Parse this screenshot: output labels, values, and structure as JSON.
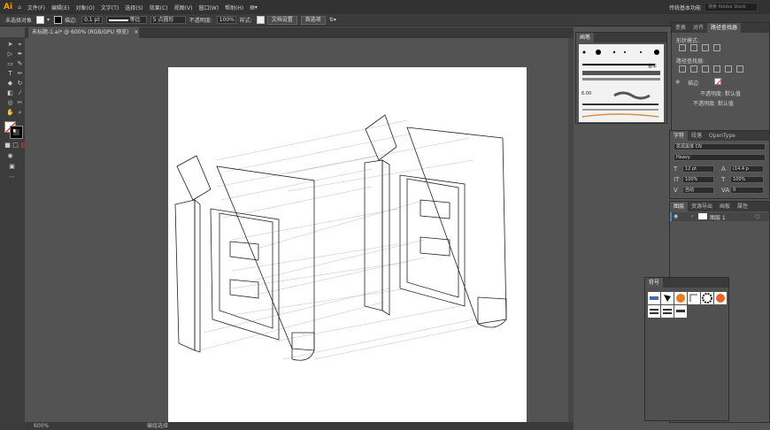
{
  "app": {
    "logo": "Ai"
  },
  "menu": [
    "文件(F)",
    "编辑(E)",
    "对象(O)",
    "文字(T)",
    "选择(S)",
    "效果(C)",
    "视图(V)",
    "窗口(W)",
    "帮助(H)"
  ],
  "workspace": "传统基本功能",
  "search_placeholder": "搜索 Adobe Stock",
  "control_bar": {
    "selection": "未选择对象",
    "stroke_label": "描边:",
    "stroke_weight": "0.1 pt",
    "stroke_style": "等比",
    "brush": "5 点圆形",
    "opacity_label": "不透明度:",
    "opacity": "100%",
    "style_label": "样式:",
    "doc_setup": "文档设置",
    "preferences": "首选项"
  },
  "document_tab": {
    "title": "未标题-1.ai* @ 600% (RGB/GPU 预览)",
    "close": "×"
  },
  "status": {
    "zoom": "600%",
    "tool": "编组选择"
  },
  "brushes_panel": {
    "title": "画笔",
    "basic_label": "基本",
    "size": "6.00"
  },
  "pathfinder_panel": {
    "tabs": [
      "变换",
      "对齐",
      "路径查找器"
    ],
    "shape_modes": "形状模式:",
    "pathfinder": "路径查找器:",
    "appearance": {
      "label": "描边",
      "opacity1": "不透明度: 默认值",
      "opacity2": "不透明度: 默认值"
    }
  },
  "char_panel": {
    "tabs": [
      "字符",
      "段落",
      "OpenType"
    ],
    "font": "思源黑体 CN",
    "style": "Heavy",
    "size": "12 pt",
    "leading": "(14.4 p",
    "scale_v": "100%",
    "scale_h": "100%",
    "kerning": "自动",
    "tracking": "0"
  },
  "layers_panel": {
    "tabs": [
      "图层",
      "资源导出",
      "画板",
      "属性"
    ],
    "layer_name": "图层 1"
  },
  "symbols_panel": {
    "title": "符号"
  }
}
